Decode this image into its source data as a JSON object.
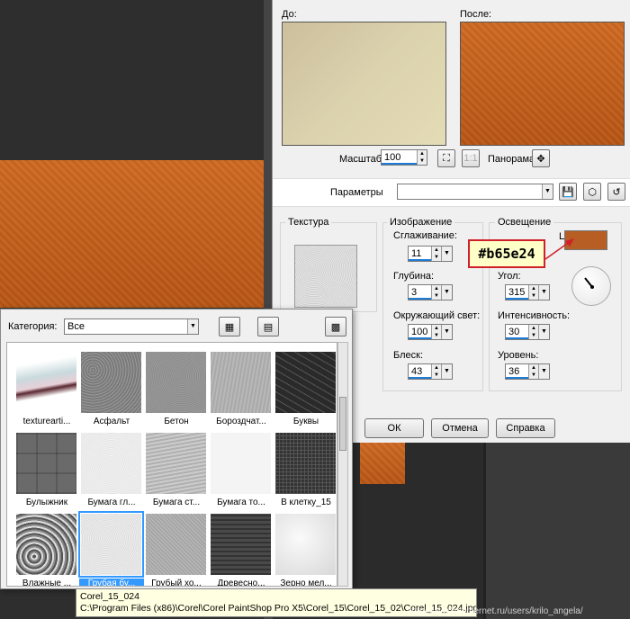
{
  "colors": {
    "chosen": "#b65e24",
    "accent": "#3399ff"
  },
  "preview": {
    "before_label": "До:",
    "after_label": "После:"
  },
  "zoom": {
    "label": "Масштаб:",
    "value": "100",
    "pan_label": "Панорама:"
  },
  "params": {
    "label": "Параметры",
    "value": ""
  },
  "texture": {
    "label": "Текстура"
  },
  "image_group": {
    "label": "Изображение",
    "smoothing": {
      "label": "Сглаживание:",
      "value": "11"
    },
    "depth": {
      "label": "Глубина:",
      "value": "3"
    },
    "ambient": {
      "label": "Окружающий свет:",
      "value": "100"
    },
    "gloss": {
      "label": "Блеск:",
      "value": "43"
    }
  },
  "lighting": {
    "label": "Освещение",
    "color_label": "Цвет:",
    "color_hex": "#b65e24",
    "angle": {
      "label": "Угол:",
      "value": "315"
    },
    "intensity": {
      "label": "Интенсивность:",
      "value": "30"
    },
    "level": {
      "label": "Уровень:",
      "value": "36"
    }
  },
  "buttons": {
    "ok": "ОК",
    "cancel": "Отмена",
    "help": "Справка"
  },
  "popup": {
    "category_label": "Категория:",
    "category_value": "Все",
    "tiles": [
      {
        "label": "texturearti..."
      },
      {
        "label": "Асфальт"
      },
      {
        "label": "Бетон"
      },
      {
        "label": "Бороздчат..."
      },
      {
        "label": "Буквы"
      },
      {
        "label": "Булыжник"
      },
      {
        "label": "Бумага гл..."
      },
      {
        "label": "Бумага ст..."
      },
      {
        "label": "Бумага то..."
      },
      {
        "label": "В клетку_15"
      },
      {
        "label": "Влажные ..."
      },
      {
        "label": "Грубая бу..."
      },
      {
        "label": "Грубый хо..."
      },
      {
        "label": "Древесно..."
      },
      {
        "label": "Зерно мел..."
      }
    ]
  },
  "tooltip": {
    "name": "Corel_15_024",
    "path": "C:\\Program Files (x86)\\Corel\\Corel PaintShop Pro X5\\Corel_15\\Corel_15_02\\Corel_15_024.jpg"
  },
  "watermark": "http://www.liveinternet.ru/users/krilo_angela/"
}
